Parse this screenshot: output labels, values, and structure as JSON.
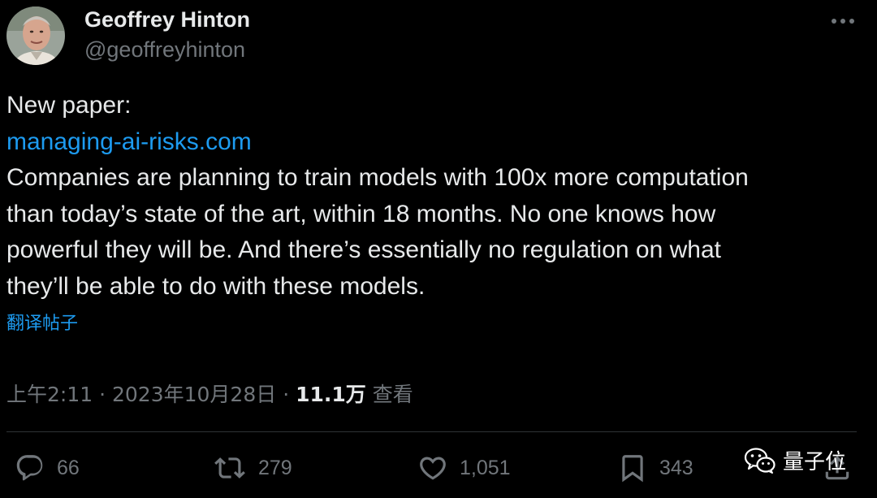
{
  "author": {
    "display_name": "Geoffrey Hinton",
    "handle": "@geoffreyhinton",
    "avatar_icon": "profile-photo"
  },
  "tweet": {
    "lines": [
      "New paper:",
      "managing-ai-risks.com",
      "Companies are planning to train models with 100x more computation",
      "than today’s state of the art, within 18 months. No one knows how",
      "powerful they will be. And there’s essentially no regulation on what",
      "they’ll be able to do with these models."
    ],
    "link_color": "#1d9bf0",
    "translate_label": "翻译帖子"
  },
  "meta": {
    "time": "上午2:11",
    "separator": "·",
    "date": "2023年10月28日",
    "views_count": "11.1万",
    "views_label": "查看"
  },
  "actions": {
    "replies": "66",
    "reposts": "279",
    "likes": "1,051",
    "bookmarks": "343"
  },
  "watermark": {
    "text": "量子位",
    "icon": "wechat-icon"
  },
  "colors": {
    "background": "#000000",
    "text": "#e7e9ea",
    "secondary": "#71767b",
    "accent": "#1d9bf0"
  }
}
